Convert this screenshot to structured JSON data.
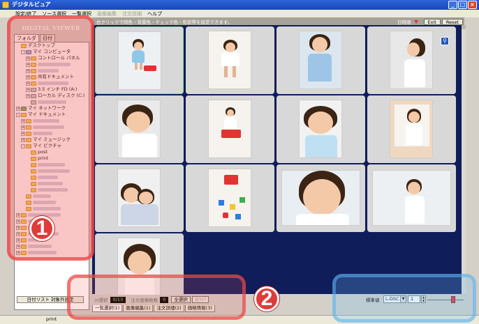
{
  "window": {
    "title": "デジタルビュア",
    "controls": {
      "minimize": "_",
      "maximize": "□",
      "close": "×"
    }
  },
  "menu": [
    {
      "label": "設定/終了",
      "enabled": true
    },
    {
      "label": "ソース選択",
      "enabled": true
    },
    {
      "label": "一覧選択",
      "enabled": true
    },
    {
      "label": "画像編集",
      "enabled": false
    },
    {
      "label": "注文詳細",
      "enabled": false
    },
    {
      "label": "ヘルプ",
      "enabled": true
    }
  ],
  "left_panel": {
    "brand": "DIGITAL VIEWER",
    "tabs": [
      "フォルダ",
      "日付"
    ],
    "tree": [
      {
        "indent": 0,
        "toggle": "",
        "icon": "folder",
        "label": "デスクトップ"
      },
      {
        "indent": 1,
        "toggle": "-",
        "icon": "pc",
        "label": "マイ コンピュータ"
      },
      {
        "indent": 2,
        "toggle": "+",
        "icon": "folder",
        "label": "コントロール パネル"
      },
      {
        "indent": 2,
        "toggle": "+",
        "icon": "folder",
        "label": "",
        "blurred": true
      },
      {
        "indent": 2,
        "toggle": "+",
        "icon": "folder",
        "label": "",
        "blurred": true
      },
      {
        "indent": 2,
        "toggle": "+",
        "icon": "folder",
        "label": "共有ドキュメント"
      },
      {
        "indent": 2,
        "toggle": "+",
        "icon": "folder",
        "label": "",
        "blurred": true
      },
      {
        "indent": 2,
        "toggle": "+",
        "icon": "drive",
        "label": "3.5 インチ FD (A:)"
      },
      {
        "indent": 2,
        "toggle": "+",
        "icon": "drive",
        "label": "ローカル ディスク (C:)"
      },
      {
        "indent": 2,
        "toggle": "",
        "icon": "drive",
        "label": "",
        "blurred": true
      },
      {
        "indent": 0,
        "toggle": "+",
        "icon": "net",
        "label": "マイ ネットワーク"
      },
      {
        "indent": 0,
        "toggle": "-",
        "icon": "folder",
        "label": "マイ ドキュメント"
      },
      {
        "indent": 1,
        "toggle": "+",
        "icon": "folder",
        "label": "",
        "blurred": true
      },
      {
        "indent": 1,
        "toggle": "+",
        "icon": "folder",
        "label": "",
        "blurred": true
      },
      {
        "indent": 1,
        "toggle": "+",
        "icon": "folder",
        "label": "",
        "blurred": true
      },
      {
        "indent": 1,
        "toggle": "+",
        "icon": "folder",
        "label": "マイ ミュージック"
      },
      {
        "indent": 1,
        "toggle": "-",
        "icon": "folder",
        "label": "マイ ピクチャ"
      },
      {
        "indent": 2,
        "toggle": "",
        "icon": "folder",
        "label": "post"
      },
      {
        "indent": 2,
        "toggle": "",
        "icon": "folder",
        "label": "print"
      },
      {
        "indent": 2,
        "toggle": "",
        "icon": "folder",
        "label": "",
        "blurred": true
      },
      {
        "indent": 2,
        "toggle": "",
        "icon": "folder",
        "label": "",
        "blurred": true
      },
      {
        "indent": 2,
        "toggle": "",
        "icon": "folder",
        "label": "",
        "blurred": true
      },
      {
        "indent": 2,
        "toggle": "",
        "icon": "folder",
        "label": "",
        "blurred": true
      },
      {
        "indent": 2,
        "toggle": "",
        "icon": "folder",
        "label": "",
        "blurred": true
      },
      {
        "indent": 1,
        "toggle": "",
        "icon": "folder",
        "label": "",
        "blurred": true
      },
      {
        "indent": 1,
        "toggle": "",
        "icon": "folder",
        "label": "",
        "blurred": true
      },
      {
        "indent": 1,
        "toggle": "",
        "icon": "folder",
        "label": "",
        "blurred": true
      },
      {
        "indent": 0,
        "toggle": "+",
        "icon": "folder",
        "label": "",
        "blurred": true
      },
      {
        "indent": 0,
        "toggle": "+",
        "icon": "folder",
        "label": "",
        "blurred": true
      },
      {
        "indent": 0,
        "toggle": "+",
        "icon": "folder",
        "label": "",
        "blurred": true
      },
      {
        "indent": 0,
        "toggle": "+",
        "icon": "folder",
        "label": "",
        "blurred": true
      },
      {
        "indent": 0,
        "toggle": "+",
        "icon": "folder",
        "label": "",
        "blurred": true
      },
      {
        "indent": 0,
        "toggle": "+",
        "icon": "folder",
        "label": "",
        "blurred": true
      },
      {
        "indent": 0,
        "toggle": "+",
        "icon": "folder",
        "label": "",
        "blurred": true
      }
    ],
    "date_button": "日付リスト 対象外設定"
  },
  "info_strip": {
    "text": "右クリックで時色・背景色・チェック色・形状等を設定できます。",
    "right_label": "日時順",
    "exit": "Exit",
    "reset": "Reset"
  },
  "thumbnails": [
    {
      "selected": true,
      "scene": "girl-with-toy"
    },
    {
      "selected": false,
      "scene": "girl-sitting"
    },
    {
      "selected": false,
      "scene": "girl-overalls"
    },
    {
      "selected": false,
      "scene": "girl-profile"
    },
    {
      "selected": false,
      "scene": "girl-closeup"
    },
    {
      "selected": false,
      "scene": "girl-on-bike"
    },
    {
      "selected": false,
      "scene": "girl-smiling"
    },
    {
      "selected": false,
      "scene": "girl-window"
    },
    {
      "selected": false,
      "scene": "mother-daughter"
    },
    {
      "selected": false,
      "scene": "toys"
    },
    {
      "selected": false,
      "scene": "girl-wide-face",
      "wide": true
    },
    {
      "selected": false,
      "scene": "girl-at-wall",
      "wide": true
    },
    {
      "selected": false,
      "scene": "girl-head"
    }
  ],
  "bottom_bar": {
    "select_count_label": "ｺﾏ選択",
    "select_count": "0/13",
    "order_total_label": "注文画像枚数",
    "order_total": "0",
    "select_all": "全選択",
    "deselect_all": "全ｸﾘｱ",
    "sort_label": "標準値",
    "sort_value": "L-DSC",
    "page_value": "1"
  },
  "tabs": [
    {
      "label": "一覧選択(1)",
      "active": true
    },
    {
      "label": "画像編集(1)",
      "active": false
    },
    {
      "label": "注文詳細(2)",
      "active": false
    },
    {
      "label": "価格情報(3)",
      "active": false
    }
  ],
  "status_bar": {
    "text": "print"
  },
  "annotations": {
    "badge_1": "1",
    "badge_2": "2"
  },
  "colors": {
    "grid_background": "#0f1d5a",
    "highlight_red": "#e03b3b",
    "highlight_blue": "#6ebef5"
  }
}
